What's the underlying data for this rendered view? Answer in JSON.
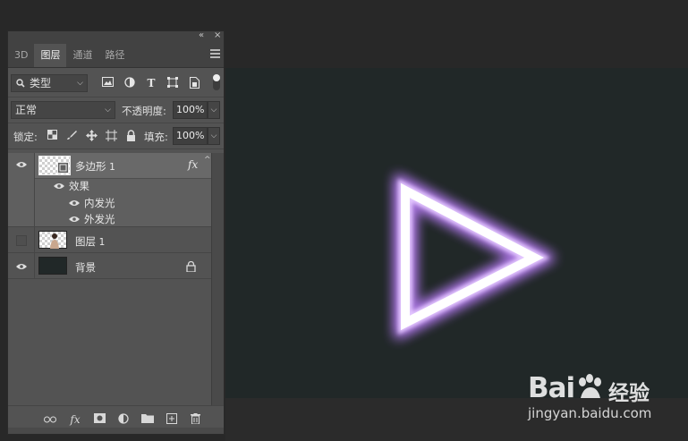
{
  "panel": {
    "controls": {
      "collapse": "«",
      "close": "×"
    },
    "tabs": [
      {
        "label": "3D",
        "active": false
      },
      {
        "label": "图层",
        "active": true
      },
      {
        "label": "通道",
        "active": false
      },
      {
        "label": "路径",
        "active": false
      }
    ],
    "filter": {
      "kind_label": "类型"
    },
    "blend": {
      "mode": "正常",
      "opacity_label": "不透明度:",
      "opacity_value": "100%"
    },
    "lock": {
      "label": "锁定:",
      "fill_label": "填充:",
      "fill_value": "100%"
    },
    "layers": [
      {
        "name": "多边形",
        "suffix": "1",
        "visible": true,
        "selected": true,
        "fx": "fx",
        "effects_label": "效果",
        "effects": [
          "内发光",
          "外发光"
        ]
      },
      {
        "name": "图层",
        "suffix": "1",
        "visible": false
      },
      {
        "name": "背景",
        "visible": true,
        "locked": true
      }
    ]
  },
  "watermark": {
    "brand": "Bai",
    "brand_tail": "du",
    "cn": "经验",
    "url": "jingyan.baidu.com"
  },
  "colors": {
    "canvas": "#212828",
    "neon_core": "#ffffff",
    "neon_glow": "#c48cff",
    "panel_bg": "#535353"
  }
}
